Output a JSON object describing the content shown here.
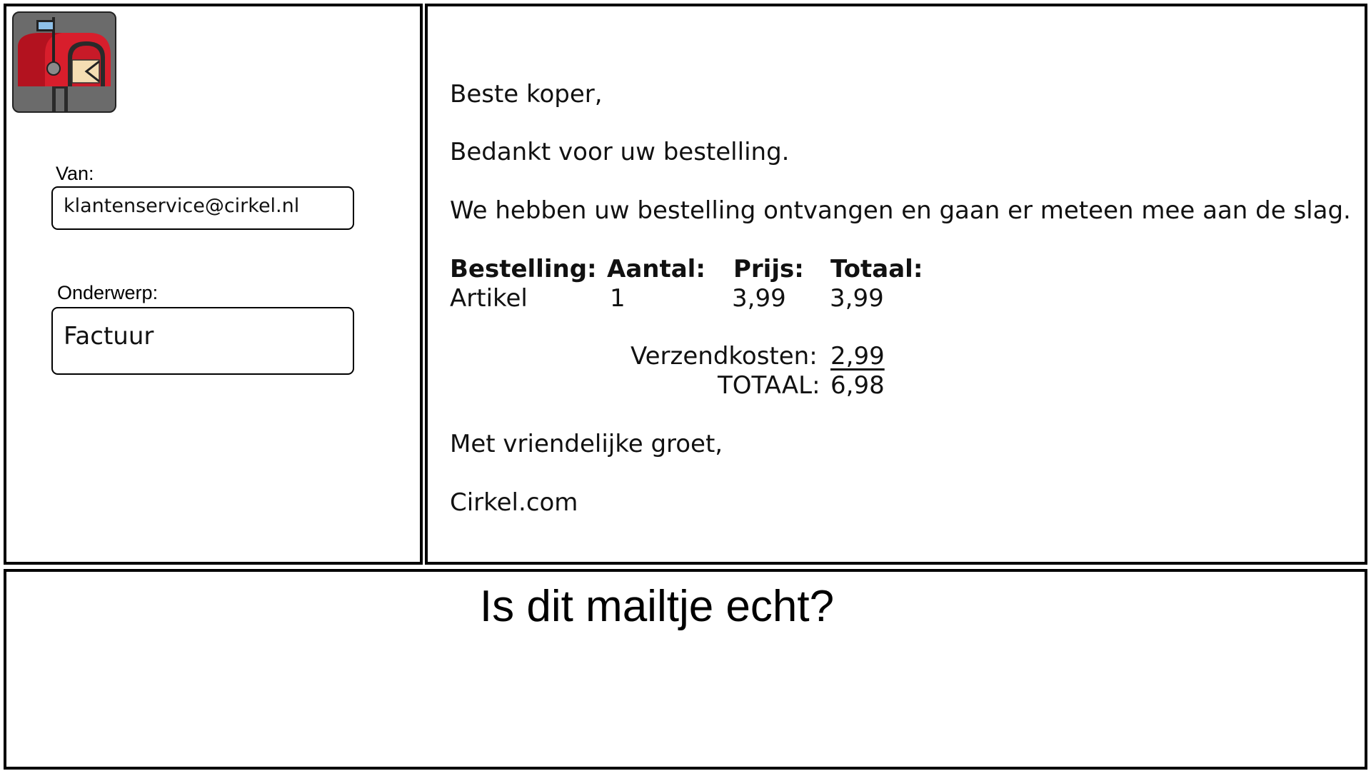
{
  "sender": {
    "label": "Van:",
    "value": "klantenservice@cirkel.nl"
  },
  "subject": {
    "label": "Onderwerp:",
    "value": "Factuur"
  },
  "mail": {
    "greeting": "Beste koper,",
    "thanks": "Bedankt voor uw bestelling.",
    "body": "We hebben uw bestelling ontvangen en gaan er meteen mee aan de slag.",
    "table": {
      "headers": [
        "Bestelling:",
        "Aantal:",
        "Prijs:",
        "Totaal:"
      ],
      "rows": [
        [
          "Artikel",
          "1",
          "3,99",
          "3,99"
        ]
      ]
    },
    "shipping_label": "Verzendkosten:",
    "shipping_value": "2,99",
    "total_label": "TOTAAL:",
    "total_value": "6,98",
    "closing": "Met vriendelijke groet,",
    "signature": "Cirkel.com"
  },
  "question": "Is dit mailtje echt?",
  "icons": {
    "logo": "mailbox-icon"
  },
  "colors": {
    "mailbox_red": "#d81e2c",
    "logo_background": "#6b6b6b"
  }
}
